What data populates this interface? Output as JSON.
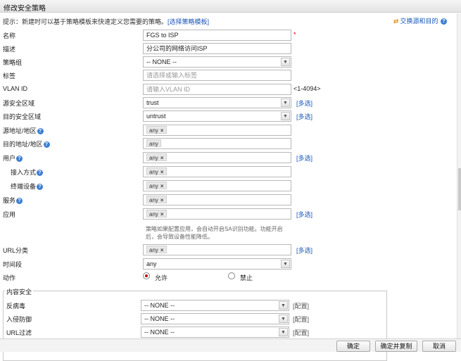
{
  "window": {
    "title": "修改安全策略"
  },
  "tip": {
    "text": "提示：新建时可以基于策略模板来快速定义您需要的策略。",
    "link": "[选择策略模板]"
  },
  "swap_link": "交换源和目的",
  "form": {
    "name": {
      "label": "名称",
      "value": "FGS to ISP",
      "required_mark": "*"
    },
    "description": {
      "label": "描述",
      "value": "分公司的网络访问ISP"
    },
    "policy_group": {
      "label": "策略组",
      "value": "-- NONE --"
    },
    "tag": {
      "label": "标签",
      "placeholder": "请选择或输入标签"
    },
    "vlan_id": {
      "label": "VLAN ID",
      "placeholder": "请输入VLAN ID",
      "range": "<1-4094>"
    },
    "src_zone": {
      "label": "源安全区域",
      "value": "trust",
      "multi": "[多选]"
    },
    "dst_zone": {
      "label": "目的安全区域",
      "value": "untrust",
      "multi": "[多选]"
    },
    "src_addr": {
      "label": "源地址/地区",
      "tag": "any"
    },
    "dst_addr": {
      "label": "目的地址/地区",
      "tag": "any"
    },
    "user": {
      "label": "用户",
      "tag": "any",
      "multi": "[多选]"
    },
    "access_method": {
      "label": "接入方式",
      "tag": "any"
    },
    "terminal_device": {
      "label": "终端设备",
      "tag": "any"
    },
    "service": {
      "label": "服务",
      "tag": "any"
    },
    "application": {
      "label": "应用",
      "tag": "any",
      "multi": "[多选]"
    },
    "app_note": "策略如果配置应用，会自动开启SA识别功能。功能开启后，会导致设备性能降低。",
    "url_category": {
      "label": "URL分类",
      "tag": "any",
      "multi": "[多选]"
    },
    "time_range": {
      "label": "时间段",
      "value": "any"
    },
    "action": {
      "label": "动作",
      "allow": "允许",
      "deny": "禁止",
      "selected": "允许"
    }
  },
  "content_security": {
    "legend": "内容安全",
    "antivirus": {
      "label": "反病毒",
      "value": "-- NONE --",
      "config": "[配置]"
    },
    "ips": {
      "label": "入侵防御",
      "value": "-- NONE --",
      "config": "[配置]"
    },
    "url_filter": {
      "label": "URL过滤",
      "value": "-- NONE --",
      "config": "[配置]"
    }
  },
  "footer": {
    "ok": "确定",
    "ok_copy": "确定并复制",
    "cancel": "取消"
  }
}
